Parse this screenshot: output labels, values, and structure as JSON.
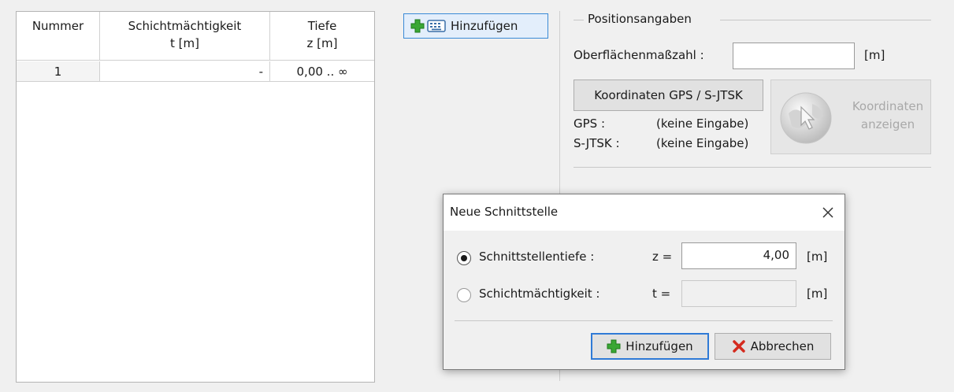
{
  "table": {
    "columns": [
      {
        "name": "Nummer",
        "unit": ""
      },
      {
        "name": "Schichtmächtigkeit",
        "unit": "t [m]"
      },
      {
        "name": "Tiefe",
        "unit": "z [m]"
      }
    ],
    "rows": [
      {
        "number": "1",
        "thickness": "-",
        "depth": "0,00 .. ∞"
      }
    ]
  },
  "toolbar": {
    "add_label": "Hinzufügen",
    "add_icon": "plus-keyboard-icon"
  },
  "position": {
    "group_title": "Positionsangaben",
    "surface_label": "Oberflächenmaßzahl :",
    "surface_value": "",
    "surface_unit": "[m]",
    "gps_button": "Koordinaten GPS / S-JTSK",
    "gps_label": "GPS :",
    "gps_value": "(keine Eingabe)",
    "sjtsk_label": "S-JTSK :",
    "sjtsk_value": "(keine Eingabe)",
    "show_button_line1": "Koordinaten",
    "show_button_line2": "anzeigen",
    "show_button_icon": "globe-cursor-icon"
  },
  "dialog": {
    "title": "Neue Schnittstelle",
    "close_icon": "close-icon",
    "option1_label": "Schnittstellentiefe :",
    "option1_var": "z =",
    "option1_value": "4,00",
    "option1_unit": "[m]",
    "option1_selected": true,
    "option2_label": "Schichtmächtigkeit :",
    "option2_var": "t =",
    "option2_value": "",
    "option2_unit": "[m]",
    "option2_selected": false,
    "add_label": "Hinzufügen",
    "cancel_label": "Abbrechen"
  },
  "colors": {
    "accent": "#2f7ad6",
    "plus_green": "#3aa735",
    "cancel_red": "#d42a1e"
  }
}
